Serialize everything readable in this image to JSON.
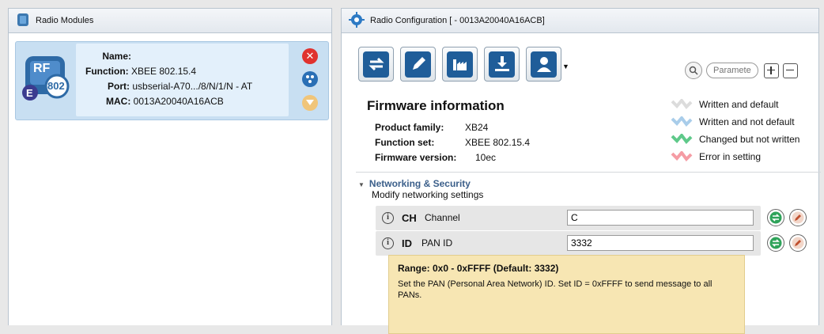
{
  "left_panel": {
    "title": "Radio Modules",
    "module": {
      "name_label": "Name:",
      "name_value": "",
      "function_label": "Function:",
      "function_value": "XBEE 802.15.4",
      "port_label": "Port:",
      "port_value": "usbserial-A70.../8/N/1/N - AT",
      "mac_label": "MAC:",
      "mac_value": "0013A20040A16ACB",
      "icon_text_rf": "RF",
      "icon_text_e": "E",
      "icon_text_802": "802"
    }
  },
  "right_panel": {
    "title": "Radio Configuration [  - 0013A20040A16ACB]",
    "toolbar": {
      "buttons": [
        "read-icon",
        "write-icon",
        "default-icon",
        "update-icon",
        "profile-icon"
      ]
    },
    "search": {
      "placeholder": "Paramete"
    },
    "firmware": {
      "title": "Firmware information",
      "product_family_label": "Product family:",
      "product_family_value": "XB24",
      "function_set_label": "Function set:",
      "function_set_value": "XBEE 802.15.4",
      "firmware_version_label": "Firmware version:",
      "firmware_version_value": "10ec"
    },
    "legend": [
      {
        "label": "Written and default",
        "color": "#dcdcdc"
      },
      {
        "label": "Written and not default",
        "color": "#a9cdea"
      },
      {
        "label": "Changed but not written",
        "color": "#5fc98a"
      },
      {
        "label": "Error in setting",
        "color": "#f59ca4"
      }
    ],
    "section": {
      "title": "Networking & Security",
      "subtitle": "Modify networking settings"
    },
    "params": [
      {
        "code": "CH",
        "name": "Channel",
        "value": "C"
      },
      {
        "code": "ID",
        "name": "PAN ID",
        "value": "3332"
      }
    ],
    "tooltip": {
      "range": "Range: 0x0 - 0xFFFF (Default: 3332)",
      "description": "Set the PAN (Personal Area Network) ID. Set ID = 0xFFFF to send message to all PANs."
    }
  },
  "colors": {
    "accent_blue": "#1f5d99",
    "card_bg": "#c8dff2",
    "close_red": "#e0322f",
    "tooltip_bg": "#f7e6b3"
  }
}
